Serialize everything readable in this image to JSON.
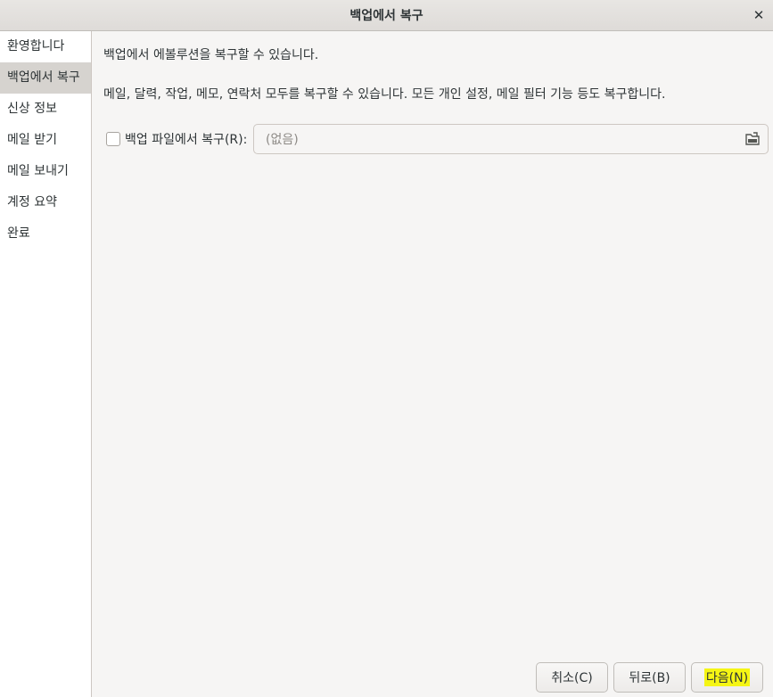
{
  "window": {
    "title": "백업에서 복구"
  },
  "sidebar": {
    "items": [
      {
        "label": "환영합니다"
      },
      {
        "label": "백업에서 복구"
      },
      {
        "label": "신상 정보"
      },
      {
        "label": "메일 받기"
      },
      {
        "label": "메일 보내기"
      },
      {
        "label": "계정 요약"
      },
      {
        "label": "완료"
      }
    ],
    "active_index": 1
  },
  "main": {
    "description1": "백업에서 에볼루션을 복구할 수 있습니다.",
    "description2": "메일, 달력, 작업, 메모, 연락처 모두를 복구할 수 있습니다. 모든 개인 설정, 메일 필터 기능 등도 복구합니다.",
    "restore_checkbox_label": "백업 파일에서 복구(R):",
    "restore_checked": false,
    "file_chooser_value": "(없음)"
  },
  "buttons": {
    "cancel": "취소(C)",
    "back": "뒤로(B)",
    "next": "다음(N)"
  },
  "icons": {
    "close": "close-icon",
    "file": "document-open-icon"
  },
  "colors": {
    "highlight": "#f5f514",
    "active_item_bg": "#d6d3cf"
  }
}
